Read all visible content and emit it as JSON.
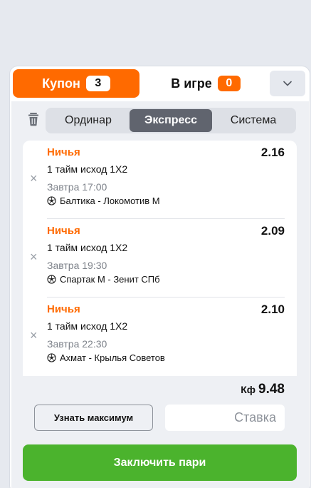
{
  "tabs": {
    "coupon": {
      "label": "Купон",
      "count": "3"
    },
    "in_game": {
      "label": "В игре",
      "count": "0"
    }
  },
  "bet_types": [
    {
      "label": "Ординар",
      "active": false
    },
    {
      "label": "Экспресс",
      "active": true
    },
    {
      "label": "Система",
      "active": false
    }
  ],
  "bets": [
    {
      "outcome": "Ничья",
      "odd": "2.16",
      "market": "1 тайм исход 1X2",
      "time": "Завтра 17:00",
      "match": "Балтика - Локомотив М"
    },
    {
      "outcome": "Ничья",
      "odd": "2.09",
      "market": "1 тайм исход 1X2",
      "time": "Завтра 19:30",
      "match": "Спартак М - Зенит СПб"
    },
    {
      "outcome": "Ничья",
      "odd": "2.10",
      "market": "1 тайм исход 1X2",
      "time": "Завтра 22:30",
      "match": "Ахмат - Крылья Советов"
    }
  ],
  "total": {
    "prefix": "Кф",
    "value": "9.48"
  },
  "max_button": "Узнать максимум",
  "stake": {
    "placeholder": "Ставка",
    "value": ""
  },
  "submit_label": "Заключить пари",
  "icons": {
    "trash": "trash-icon",
    "collapse": "chevron-down-icon",
    "remove": "close-icon",
    "sport": "soccer-ball-icon"
  },
  "colors": {
    "accent": "#ff6a00",
    "submit": "#4bb32d",
    "segment_active": "#60646e",
    "background": "#e6e9ef"
  }
}
